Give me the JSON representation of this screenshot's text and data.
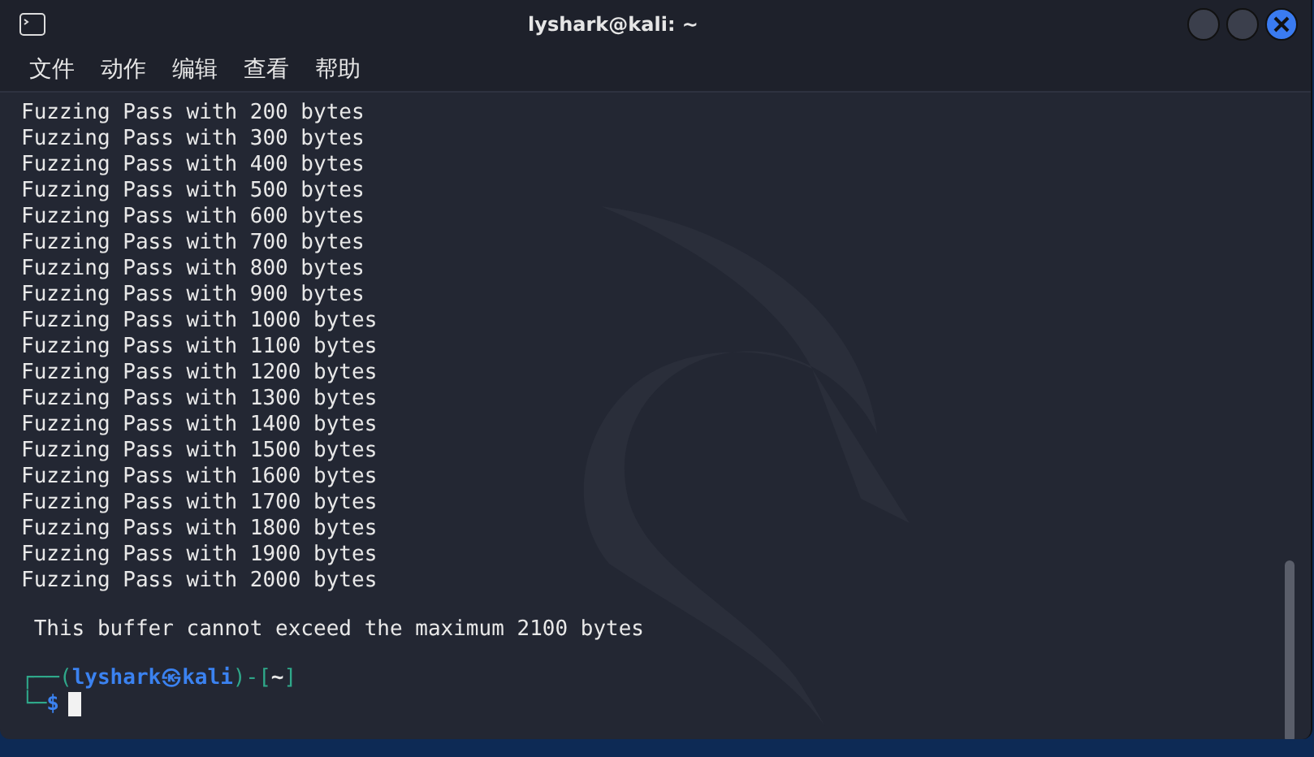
{
  "window": {
    "title": "lyshark@kali: ~"
  },
  "menu": [
    "文件",
    "动作",
    "编辑",
    "查看",
    "帮助"
  ],
  "output_lines": [
    "Fuzzing Pass with 200 bytes",
    "Fuzzing Pass with 300 bytes",
    "Fuzzing Pass with 400 bytes",
    "Fuzzing Pass with 500 bytes",
    "Fuzzing Pass with 600 bytes",
    "Fuzzing Pass with 700 bytes",
    "Fuzzing Pass with 800 bytes",
    "Fuzzing Pass with 900 bytes",
    "Fuzzing Pass with 1000 bytes",
    "Fuzzing Pass with 1100 bytes",
    "Fuzzing Pass with 1200 bytes",
    "Fuzzing Pass with 1300 bytes",
    "Fuzzing Pass with 1400 bytes",
    "Fuzzing Pass with 1500 bytes",
    "Fuzzing Pass with 1600 bytes",
    "Fuzzing Pass with 1700 bytes",
    "Fuzzing Pass with 1800 bytes",
    "Fuzzing Pass with 1900 bytes",
    "Fuzzing Pass with 2000 bytes"
  ],
  "message": " This buffer cannot exceed the maximum 2100 bytes",
  "prompt": {
    "open": "┌──(",
    "user": "lyshark",
    "at": "㉿",
    "host": "kali",
    "mid": ")-[",
    "dir": "~",
    "close": "]",
    "corner": "└─",
    "symbol": "$"
  }
}
